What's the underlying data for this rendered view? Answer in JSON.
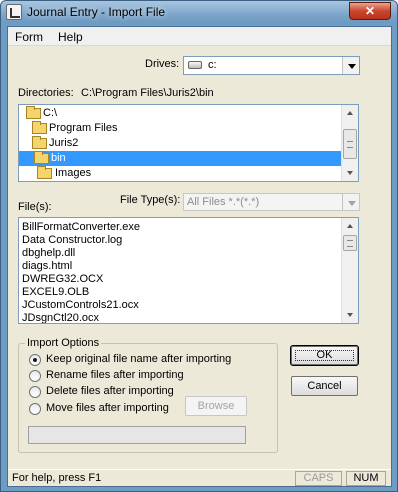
{
  "window": {
    "title": "Journal Entry - Import File",
    "close_glyph": "✕"
  },
  "menu": {
    "items": [
      {
        "label": "Form"
      },
      {
        "label": "Help"
      }
    ]
  },
  "drives": {
    "label": "Drives:",
    "value": "c:"
  },
  "directories": {
    "label": "Directories:",
    "path": "C:\\Program Files\\Juris2\\bin",
    "items": [
      {
        "label": "C:\\",
        "selected": false
      },
      {
        "label": "Program Files",
        "selected": false
      },
      {
        "label": "Juris2",
        "selected": false
      },
      {
        "label": "bin",
        "selected": true
      },
      {
        "label": "Images",
        "selected": false
      }
    ]
  },
  "file_type": {
    "label": "File Type(s):",
    "value": "All Files *.*(*.*)",
    "disabled": true
  },
  "files": {
    "label": "File(s):",
    "items": [
      "BillFormatConverter.exe",
      "Data Constructor.log",
      "dbghelp.dll",
      "diags.html",
      "DWREG32.OCX",
      "EXCEL9.OLB",
      "JCustomControls21.ocx",
      "JDsgnCtl20.ocx"
    ]
  },
  "import_options": {
    "title": "Import Options",
    "options": [
      {
        "label": "Keep original file name after importing",
        "selected": true
      },
      {
        "label": "Rename files after importing",
        "selected": false
      },
      {
        "label": "Delete files after importing",
        "selected": false
      },
      {
        "label": "Move files after importing",
        "selected": false
      }
    ],
    "browse_label": "Browse",
    "browse_disabled": true
  },
  "buttons": {
    "ok_label": "OK",
    "cancel_label": "Cancel"
  },
  "status": {
    "text": "For help, press F1",
    "caps": "CAPS",
    "num": "NUM"
  }
}
